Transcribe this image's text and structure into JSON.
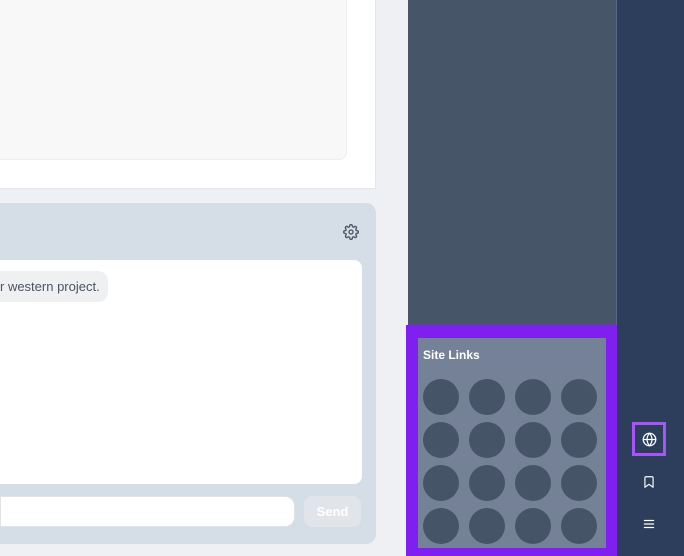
{
  "chat": {
    "message_text": "r western project.",
    "input_value": "",
    "input_placeholder": "",
    "send_label": "Send",
    "settings_icon": "gear-icon"
  },
  "site_links": {
    "title": "Site Links",
    "links": 16
  },
  "rail": {
    "items": [
      {
        "icon": "globe-icon",
        "active": true
      },
      {
        "icon": "bookmark-icon",
        "active": false
      },
      {
        "icon": "menu-icon",
        "active": false
      }
    ]
  },
  "colors": {
    "highlight": "#8020f0",
    "rail_active_border": "#a855f7",
    "side_column": "#475569",
    "rail_bg": "#2c3e5b",
    "chat_panel": "#d5dee6"
  }
}
